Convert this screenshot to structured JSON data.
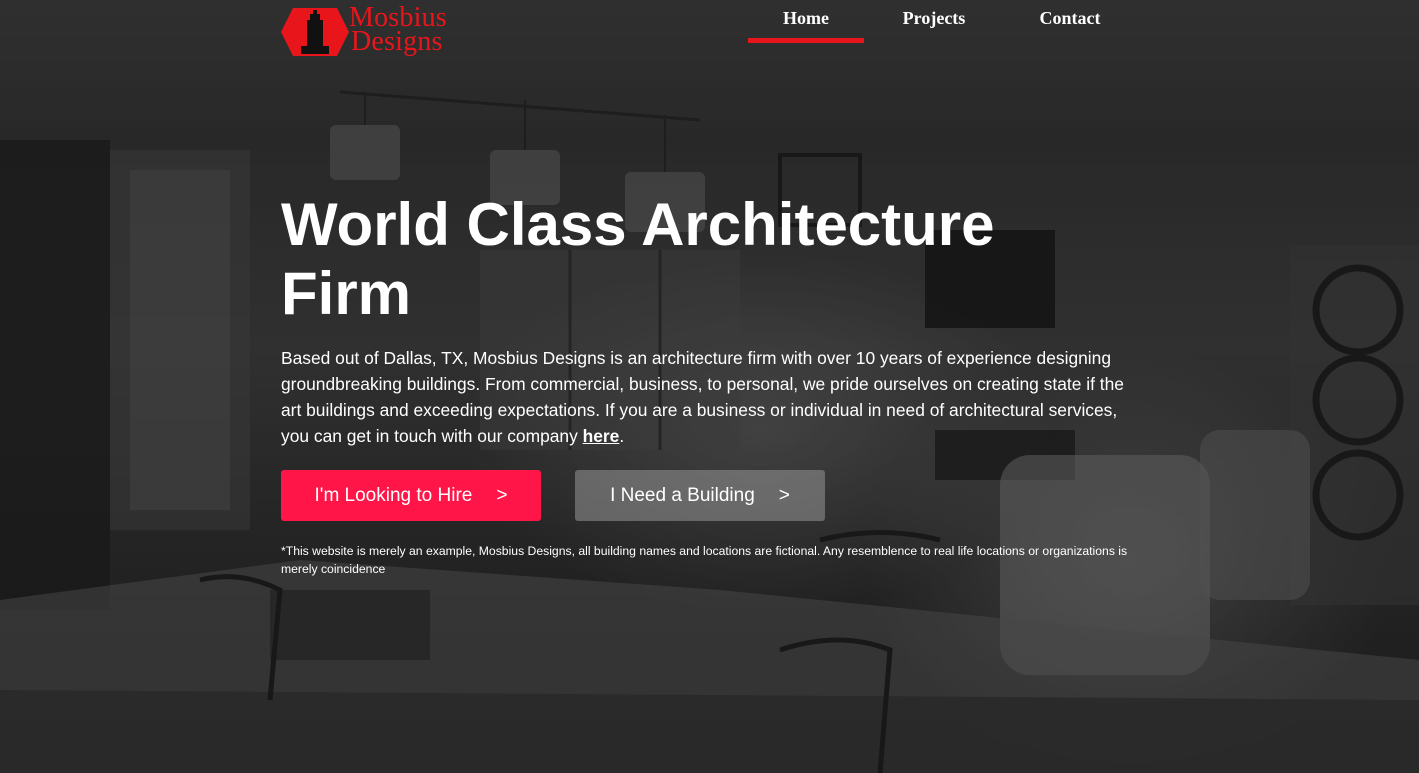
{
  "brand": {
    "line1": "Mosbius",
    "line2": "Designs",
    "accent_color": "#e8161b",
    "logo_icon": "building-hexagon-logo"
  },
  "nav": {
    "items": [
      {
        "label": "Home",
        "active": true
      },
      {
        "label": "Projects",
        "active": false
      },
      {
        "label": "Contact",
        "active": false
      }
    ],
    "active_color": "#e8161b"
  },
  "hero": {
    "title": "World Class Architecture Firm",
    "body_text": "Based out of Dallas, TX, Mosbius Designs is an architecture firm with over 10 years of experience designing groundbreaking buildings. From commercial, business, to personal, we pride ourselves on creating state if the art buildings and exceeding expectations. If you are a business or individual in need of architectural services, you can get in touch with our company ",
    "link_text": "here",
    "body_end": "."
  },
  "buttons": {
    "hire": {
      "label": "I'm Looking to Hire",
      "arrow": ">",
      "color": "#ff1547"
    },
    "building": {
      "label": "I Need a Building",
      "arrow": ">"
    }
  },
  "disclaimer": "*This website is merely an example, Mosbius Designs, all building names and locations are fictional. Any resemblence to real life locations or organizations is merely coincidence"
}
